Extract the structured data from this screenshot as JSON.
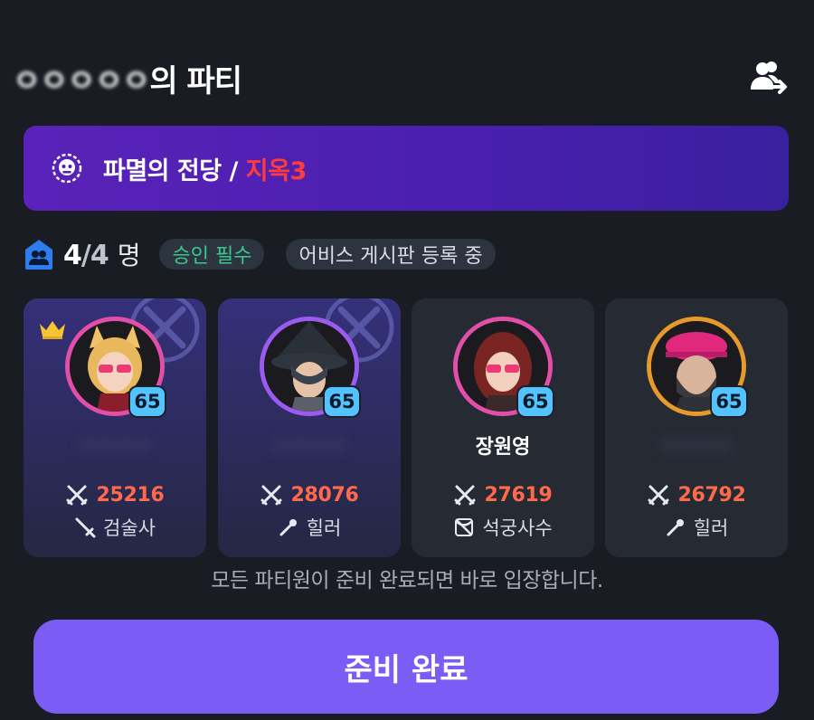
{
  "header": {
    "leader_name_blurred": "ㅇㅇㅇㅇㅇ",
    "title_suffix": "의 파티",
    "share_icon": "group-share-icon"
  },
  "dungeon": {
    "icon": "demon-face-icon",
    "name": "파멸의 전당",
    "separator": " / ",
    "difficulty": "지옥3",
    "difficulty_color": "#ff3b3b"
  },
  "party_info": {
    "icon": "party-house-icon",
    "current": "4",
    "sep": "/",
    "max": "4",
    "unit": "명",
    "chips": [
      "승인 필수",
      "어비스 게시판 등록 중"
    ]
  },
  "members": [
    {
      "level": "65",
      "name": "",
      "power": "25216",
      "class": "검술사",
      "class_icon": "sword-icon",
      "leader": true,
      "ring_color": "#e24fa8"
    },
    {
      "level": "65",
      "name": "",
      "power": "28076",
      "class": "힐러",
      "class_icon": "staff-icon",
      "leader": false,
      "ring_color": "#9c5bf0"
    },
    {
      "level": "65",
      "name": "장원영",
      "power": "27619",
      "class": "석궁사수",
      "class_icon": "crossbow-icon",
      "leader": false,
      "ring_color": "#e24fa8"
    },
    {
      "level": "65",
      "name": "",
      "power": "26792",
      "class": "힐러",
      "class_icon": "staff-icon",
      "leader": false,
      "ring_color": "#e79a2c"
    }
  ],
  "notice": "모든 파티원이 준비 완료되면 바로 입장합니다.",
  "ready_button": "준비 완료",
  "colors": {
    "accent": "#7b5cf5",
    "power": "#ff6a4d",
    "level_badge": "#53c3ff",
    "approval_chip": "#39c88c"
  }
}
